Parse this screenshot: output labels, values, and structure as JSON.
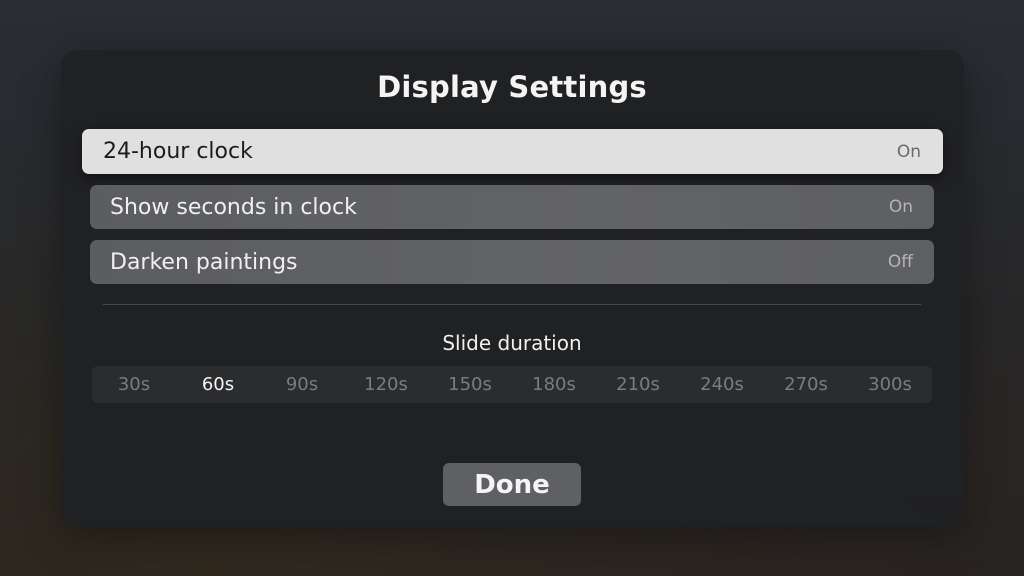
{
  "dialog": {
    "title": "Display Settings"
  },
  "settings": [
    {
      "label": "24-hour clock",
      "value": "On"
    },
    {
      "label": "Show seconds in clock",
      "value": "On"
    },
    {
      "label": "Darken paintings",
      "value": "Off"
    }
  ],
  "slide_duration": {
    "label": "Slide duration",
    "options": [
      "30s",
      "60s",
      "90s",
      "120s",
      "150s",
      "180s",
      "210s",
      "240s",
      "270s",
      "300s"
    ],
    "selected": "60s"
  },
  "done_button": {
    "label": "Done"
  }
}
